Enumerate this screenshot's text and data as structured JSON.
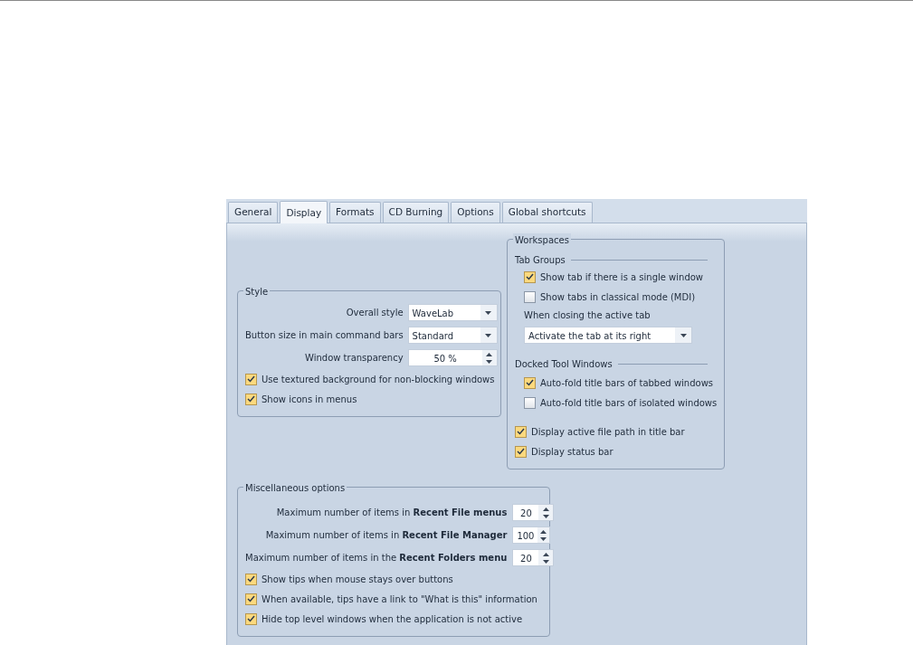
{
  "tabs": [
    {
      "label": "General",
      "selected": false
    },
    {
      "label": "Display",
      "selected": true
    },
    {
      "label": "Formats",
      "selected": false
    },
    {
      "label": "CD Burning",
      "selected": false
    },
    {
      "label": "Options",
      "selected": false
    },
    {
      "label": "Global shortcuts",
      "selected": false
    }
  ],
  "style_group": {
    "title": "Style",
    "fields": [
      {
        "kind": "dropdown",
        "label": "Overall style",
        "value": "WaveLab"
      },
      {
        "kind": "dropdown",
        "label": "Button size in main command bars",
        "value": "Standard"
      },
      {
        "kind": "spinner",
        "label": "Window transparency",
        "value": "50 %"
      }
    ],
    "checkboxes": [
      {
        "label": "Use textured background for non-blocking windows",
        "checked": true
      },
      {
        "label": "Show icons in menus",
        "checked": true
      }
    ]
  },
  "workspaces": {
    "title": "Workspaces",
    "tab_groups": {
      "title": "Tab Groups",
      "checkboxes": [
        {
          "label": "Show tab if there is a single window",
          "checked": true
        },
        {
          "label": "Show tabs in classical mode (MDI)",
          "checked": false
        }
      ],
      "dropdown_label": "When closing the active tab",
      "dropdown_value": "Activate the tab at its right"
    },
    "docked_tool_windows": {
      "title": "Docked Tool Windows",
      "checkboxes": [
        {
          "label": "Auto-fold title bars of tabbed windows",
          "checked": true
        },
        {
          "label": "Auto-fold title bars of isolated windows",
          "checked": false
        }
      ]
    },
    "checkboxes": [
      {
        "label": "Display active file path in title bar",
        "checked": true
      },
      {
        "label": "Display status bar",
        "checked": true
      }
    ]
  },
  "misc": {
    "title": "Miscellaneous options",
    "spinners": [
      {
        "label": "Maximum number of items in **Recent File menus**",
        "value": "20"
      },
      {
        "label": "Maximum number of items in **Recent File Manager**",
        "value": "100"
      },
      {
        "label": "Maximum number of items in the **Recent Folders menu**",
        "value": "20"
      }
    ],
    "checkboxes": [
      {
        "label": "Show tips when mouse stays over buttons",
        "checked": true
      },
      {
        "label": "When available, tips have a link to \"What is this\" information",
        "checked": true
      },
      {
        "label": "Hide top level windows when the application is not active",
        "checked": true
      }
    ]
  }
}
